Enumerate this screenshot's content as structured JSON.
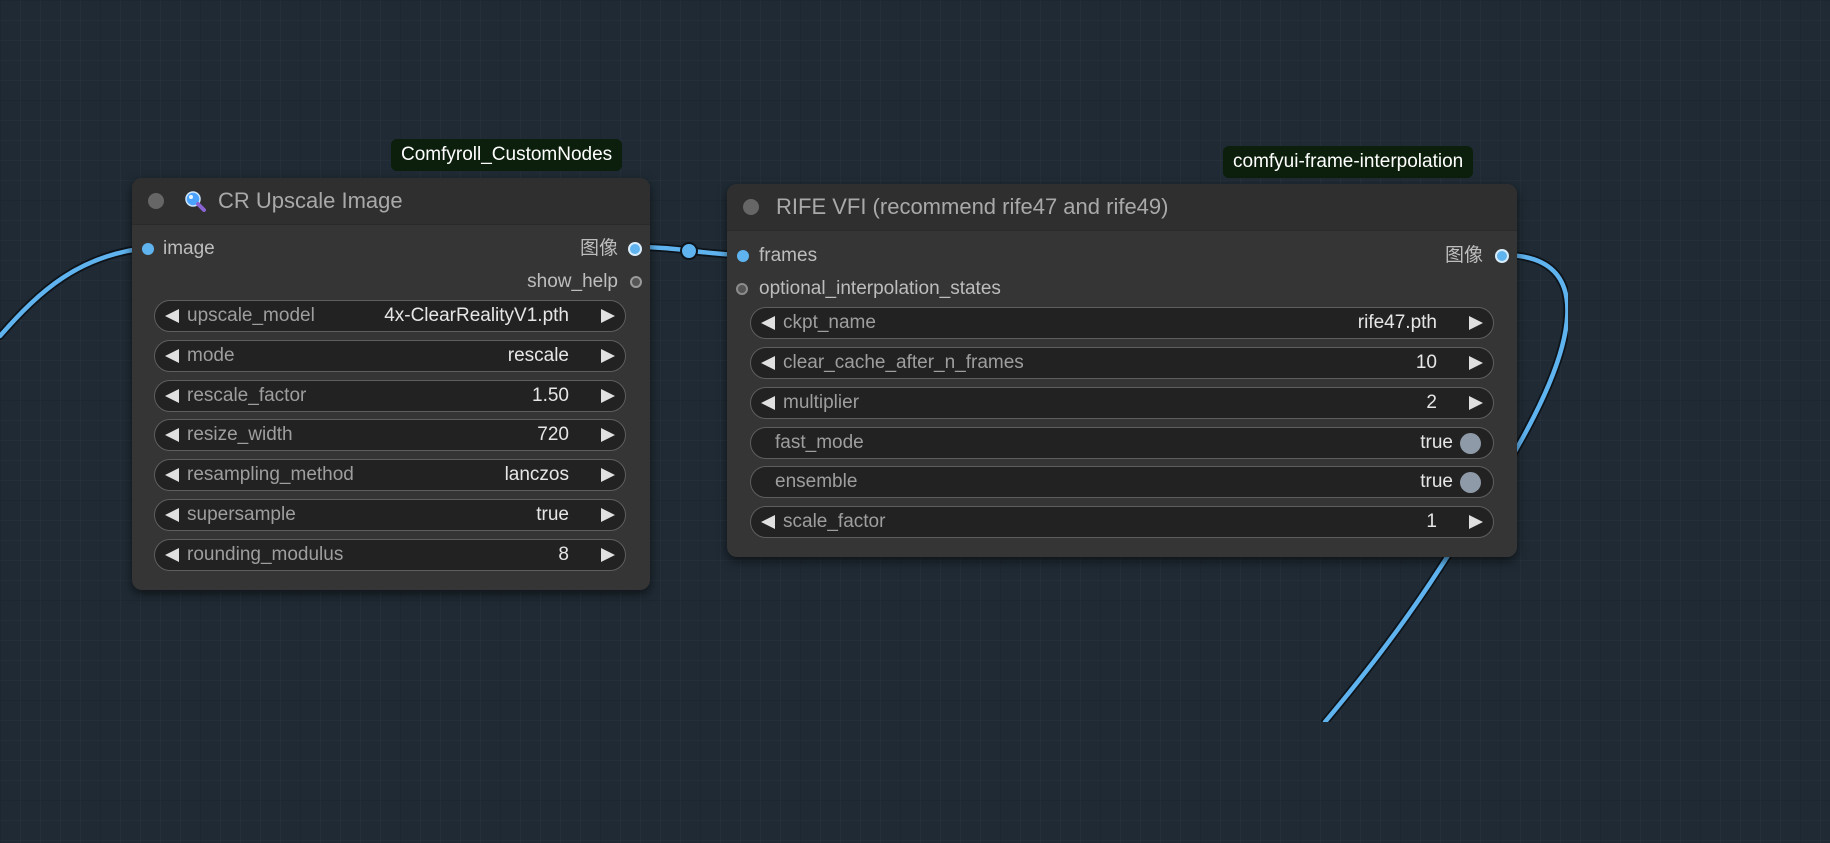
{
  "colors": {
    "canvas_background": "#1f2a34",
    "node_background": "#353535",
    "link": "#5fb4f0",
    "badge_background": "#0c1f0c"
  },
  "node_upscale": {
    "badge": "Comfyroll_CustomNodes",
    "title": "CR Upscale Image",
    "title_icon": "magnifier-icon",
    "input_image": "image",
    "output_image": "图像",
    "output_show_help": "show_help",
    "widgets": [
      {
        "label": "upscale_model",
        "value": "4x-ClearRealityV1.pth"
      },
      {
        "label": "mode",
        "value": "rescale"
      },
      {
        "label": "rescale_factor",
        "value": "1.50"
      },
      {
        "label": "resize_width",
        "value": "720"
      },
      {
        "label": "resampling_method",
        "value": "lanczos"
      },
      {
        "label": "supersample",
        "value": "true"
      },
      {
        "label": "rounding_modulus",
        "value": "8"
      }
    ]
  },
  "node_rife": {
    "badge": "comfyui-frame-interpolation",
    "title": "RIFE VFI (recommend rife47 and rife49)",
    "input_frames": "frames",
    "input_optional": "optional_interpolation_states",
    "output_image": "图像",
    "widgets": [
      {
        "label": "ckpt_name",
        "value": "rife47.pth",
        "type": "combo"
      },
      {
        "label": "clear_cache_after_n_frames",
        "value": "10",
        "type": "number"
      },
      {
        "label": "multiplier",
        "value": "2",
        "type": "number"
      },
      {
        "label": "fast_mode",
        "value": "true",
        "type": "toggle"
      },
      {
        "label": "ensemble",
        "value": "true",
        "type": "toggle"
      },
      {
        "label": "scale_factor",
        "value": "1",
        "type": "number"
      }
    ]
  }
}
